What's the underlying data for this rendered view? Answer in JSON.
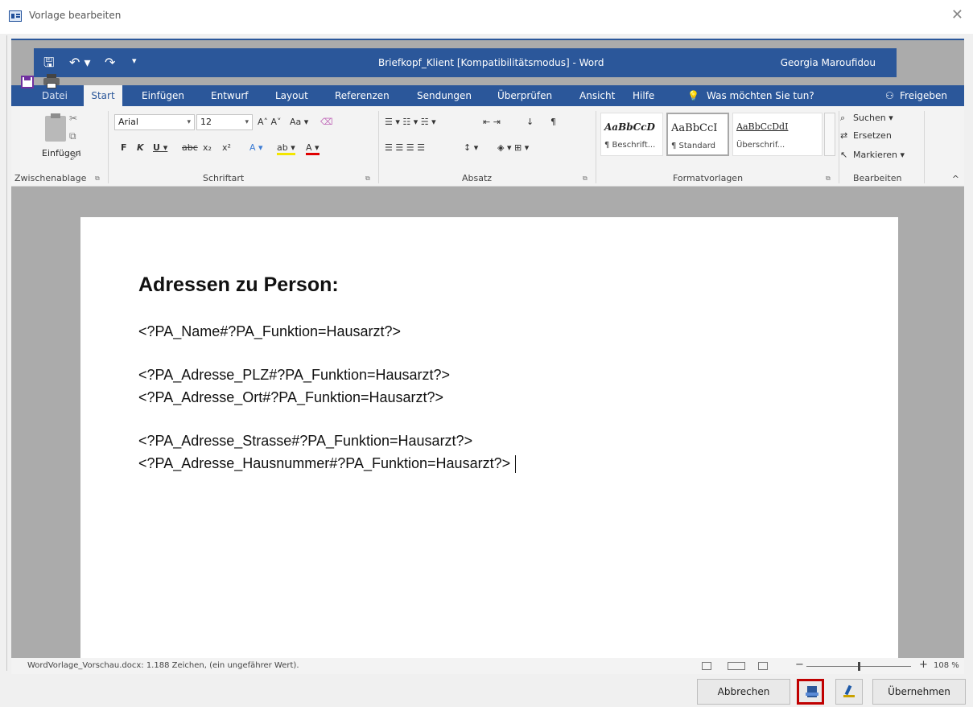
{
  "dialog": {
    "title": "Vorlage bearbeiten",
    "close_icon": "✕"
  },
  "word": {
    "document_title": "Briefkopf_Klient [Kompatibilitätsmodus]  -  Word",
    "user_name": "Georgia Maroufidou",
    "qat": {
      "save": "🖫",
      "undo": "↶ ▾",
      "redo": "↷",
      "customize": "▾"
    },
    "tabs": [
      {
        "label": "Datei"
      },
      {
        "label": "Start"
      },
      {
        "label": "Einfügen"
      },
      {
        "label": "Entwurf"
      },
      {
        "label": "Layout"
      },
      {
        "label": "Referenzen"
      },
      {
        "label": "Sendungen"
      },
      {
        "label": "Überprüfen"
      },
      {
        "label": "Ansicht"
      },
      {
        "label": "Hilfe"
      },
      {
        "label": "Was möchten Sie tun?"
      },
      {
        "label": "Freigeben"
      }
    ],
    "ribbon": {
      "clipboard": {
        "paste_label": "Einfügen",
        "group_label": "Zwischenablage"
      },
      "font": {
        "font_name": "Arial",
        "font_size": "12",
        "grow": "A˄ A˅",
        "case": "Aa ▾",
        "bold": "F",
        "italic": "K",
        "underline": "U ▾",
        "strike": "abc",
        "sub": "x₂",
        "sup": "x²",
        "effects": "A ▾",
        "highlight": "ab ▾",
        "color": "A ▾",
        "group_label": "Schriftart"
      },
      "paragraph": {
        "lists": "☰ ▾  ☷ ▾  ☵ ▾",
        "indent": "⇤ ⇥",
        "sort": "↓",
        "pilcrow": "¶",
        "align": "☰  ☰  ☰  ☰",
        "spacing": "↕ ▾",
        "shading": "◈ ▾  ⊞ ▾",
        "group_label": "Absatz"
      },
      "styles": {
        "items": [
          {
            "sample": "AaBbCcD",
            "name": "¶ Beschrift..."
          },
          {
            "sample": "AaBbCcI",
            "name": "¶ Standard"
          },
          {
            "sample": "AaBbCcDdI",
            "name": "Überschrif..."
          }
        ],
        "group_label": "Formatvorlagen"
      },
      "editing": {
        "find": "Suchen ▾",
        "replace": "Ersetzen",
        "select": "Markieren ▾",
        "group_label": "Bearbeiten"
      },
      "collapse": "^"
    },
    "document": {
      "heading": "Adressen zu Person:",
      "lines": [
        "<?PA_Name#?PA_Funktion=Hausarzt?>",
        "<?PA_Adresse_PLZ#?PA_Funktion=Hausarzt?>",
        "<?PA_Adresse_Ort#?PA_Funktion=Hausarzt?>",
        " <?PA_Adresse_Strasse#?PA_Funktion=Hausarzt?>",
        "<?PA_Adresse_Hausnummer#?PA_Funktion=Hausarzt?>"
      ]
    },
    "status": {
      "text": "WordVorlage_Vorschau.docx: 1.188 Zeichen, (ein ungefährer Wert).",
      "zoom": "108 %",
      "zoom_minus": "−",
      "zoom_plus": "+",
      "zoom_fraction": 0.5
    }
  },
  "buttons": {
    "cancel": "Abbrechen",
    "apply": "Übernehmen"
  },
  "colors": {
    "word_blue": "#2b579a",
    "highlight_red": "#c00000"
  }
}
